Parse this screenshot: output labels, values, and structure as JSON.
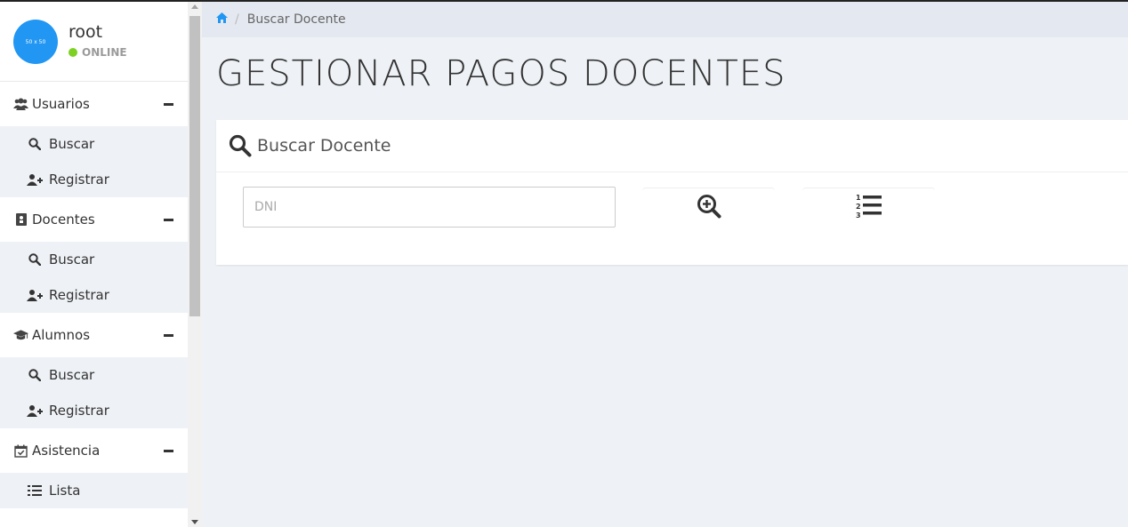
{
  "profile": {
    "avatar_text": "50 x 50",
    "username": "root",
    "status": "ONLINE"
  },
  "sidebar": {
    "sections": [
      {
        "label": "Usuarios",
        "icon": "users-icon",
        "items": [
          {
            "label": "Buscar",
            "icon": "search-icon"
          },
          {
            "label": "Registrar",
            "icon": "user-plus-icon"
          }
        ]
      },
      {
        "label": "Docentes",
        "icon": "id-badge-icon",
        "items": [
          {
            "label": "Buscar",
            "icon": "search-icon"
          },
          {
            "label": "Registrar",
            "icon": "user-plus-icon"
          }
        ]
      },
      {
        "label": "Alumnos",
        "icon": "graduation-cap-icon",
        "items": [
          {
            "label": "Buscar",
            "icon": "search-icon"
          },
          {
            "label": "Registrar",
            "icon": "user-plus-icon"
          }
        ]
      },
      {
        "label": "Asistencia",
        "icon": "calendar-check-icon",
        "items": [
          {
            "label": "Lista",
            "icon": "list-ol-icon"
          }
        ]
      }
    ]
  },
  "breadcrumb": {
    "home_icon": "home-icon",
    "separator": "/",
    "current": "Buscar Docente"
  },
  "page": {
    "title": "GESTIONAR PAGOS DOCENTES"
  },
  "card": {
    "header": "Buscar Docente",
    "header_icon": "search-icon",
    "dni_placeholder": "DNI",
    "search_button_icon": "search-plus-icon",
    "list_button_icon": "list-ol-icon"
  },
  "colors": {
    "accent": "#2196f3",
    "online": "#7cd122",
    "background": "#eef1f5",
    "breadcrumb_bg": "#e4e8f0"
  }
}
